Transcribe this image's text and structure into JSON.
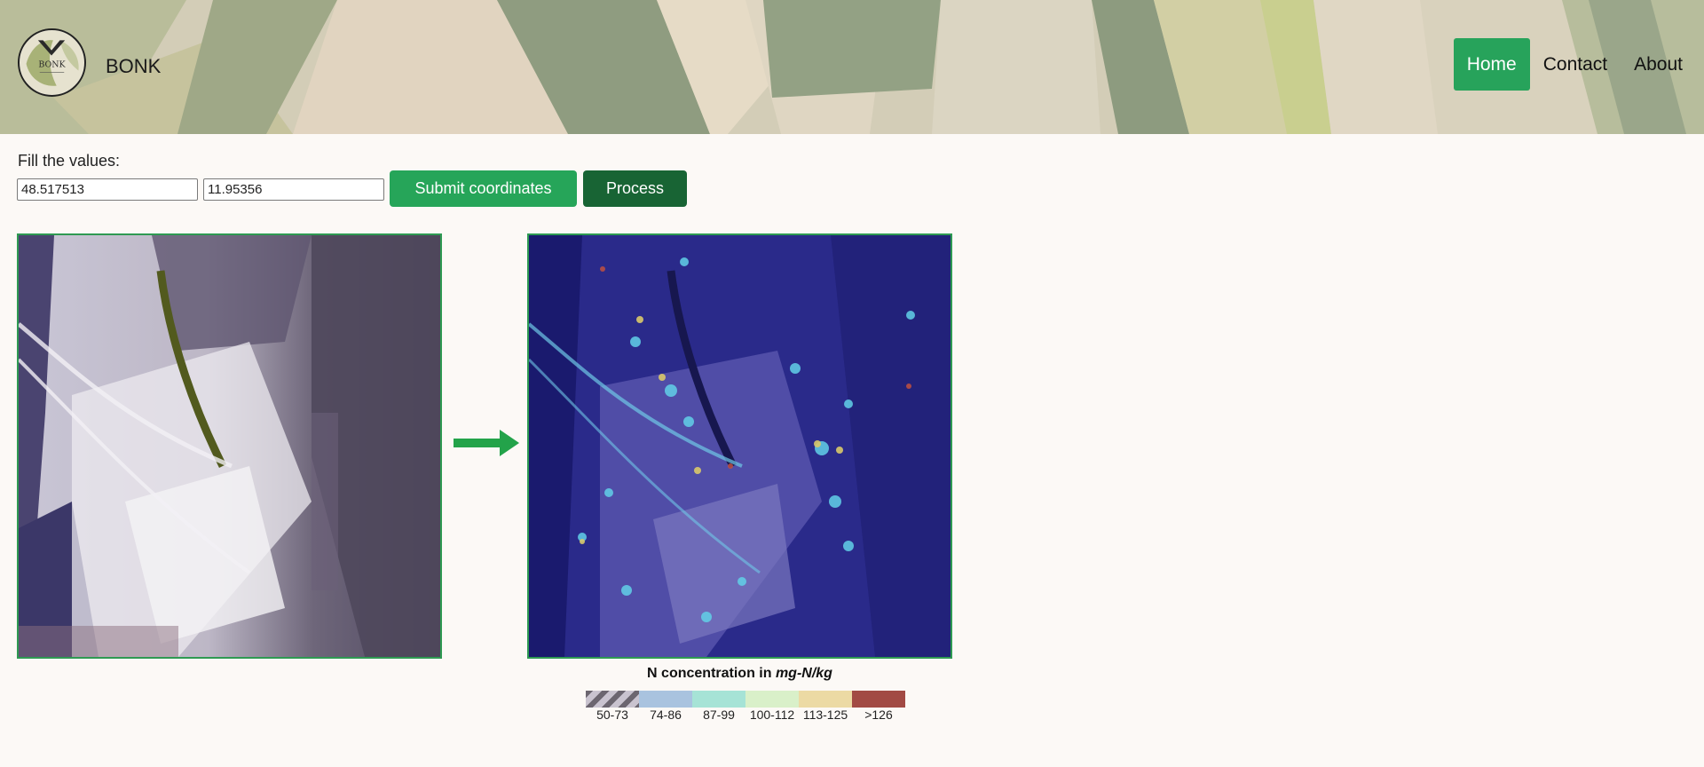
{
  "header": {
    "brand": "BONK",
    "logo_text": "BONK",
    "nav": [
      {
        "label": "Home",
        "active": true
      },
      {
        "label": "Contact",
        "active": false
      },
      {
        "label": "About",
        "active": false
      }
    ]
  },
  "form": {
    "prompt": "Fill the values:",
    "latitude_value": "48.517513",
    "longitude_value": "11.95356",
    "submit_label": "Submit coordinates",
    "process_label": "Process"
  },
  "legend": {
    "title_text": "N concentration in ",
    "title_unit": "mg-N/kg",
    "bins": [
      {
        "label": "50-73",
        "color": "#c9c3cf"
      },
      {
        "label": "74-86",
        "color": "#a9c3df"
      },
      {
        "label": "87-99",
        "color": "#a6e3d6"
      },
      {
        "label": "100-112",
        "color": "#d9f0c9"
      },
      {
        "label": "113-125",
        "color": "#ecdaa4"
      },
      {
        "label": ">126",
        "color": "#a24a44"
      }
    ]
  },
  "colors": {
    "accent": "#26a559",
    "accent_dark": "#186434",
    "panel_border": "#2e9a52"
  }
}
